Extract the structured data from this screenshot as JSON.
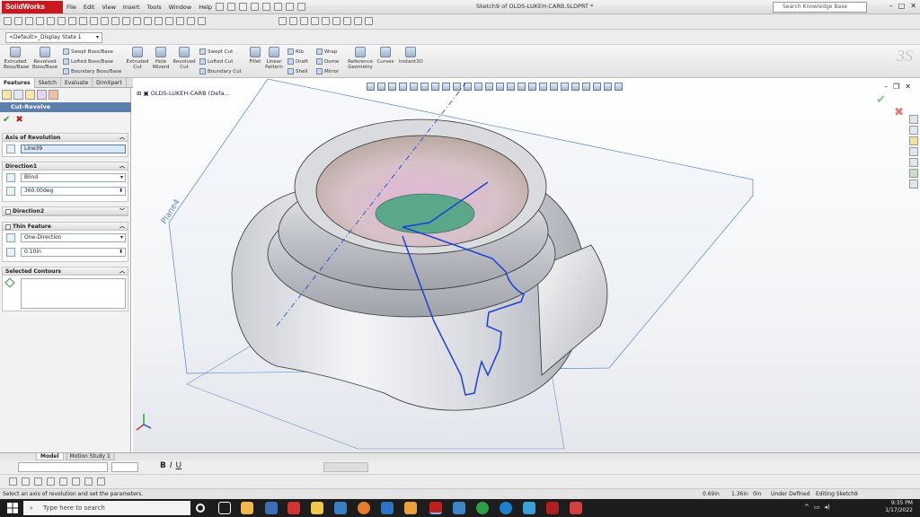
{
  "app": {
    "name": "SolidWorks",
    "doc_title": "Sketch9 of OLDS-LUKEH-CARB.SLDPRT *"
  },
  "menu": [
    "File",
    "Edit",
    "View",
    "Insert",
    "Tools",
    "Window",
    "Help"
  ],
  "search": {
    "placeholder": "Search Knowledge Base"
  },
  "config": {
    "selected": "<Default>_Display State 1"
  },
  "commands": {
    "extruded_boss": "Extruded Boss/Base",
    "revolved_boss": "Revolved Boss/Base",
    "swept_boss": "Swept Boss/Base",
    "lofted_boss": "Lofted Boss/Base",
    "boundary_boss": "Boundary Boss/Base",
    "extruded_cut": "Extruded Cut",
    "hole_wizard": "Hole Wizard",
    "revolved_cut": "Revolved Cut",
    "swept_cut": "Swept Cut",
    "lofted_cut": "Lofted Cut",
    "boundary_cut": "Boundary Cut",
    "fillet": "Fillet",
    "linear_pattern": "Linear Pattern",
    "rib": "Rib",
    "draft": "Draft",
    "shell": "Shell",
    "wrap": "Wrap",
    "dome": "Dome",
    "mirror": "Mirror",
    "reference_geometry": "Reference Geometry",
    "curves": "Curves",
    "instant3d": "Instant3D"
  },
  "cm_tabs": [
    "Features",
    "Sketch",
    "Evaluate",
    "DimXpert"
  ],
  "property_manager": {
    "title": "Cut-Revolve",
    "axis_section": "Axis of Revolution",
    "axis_value": "Line39",
    "direction1_section": "Direction1",
    "direction1_type": "Blind",
    "direction1_angle": "360.00deg",
    "direction2_section": "Direction2",
    "thin_section": "Thin Feature",
    "thin_type": "One-Direction",
    "thin_value": "0.10in",
    "contours_section": "Selected Contours"
  },
  "tree": {
    "root": "OLDS-LUKEH-CARB (Defa..."
  },
  "viewport": {
    "plane_label": "Plane4"
  },
  "bottom_tabs": [
    "Model",
    "Motion Study 1"
  ],
  "status": {
    "message": "Select an axis of revolution and set the parameters.",
    "x": "0.69in",
    "y": "1.36in",
    "z": "0in",
    "defined": "Under Defined",
    "editing": "Editing Sketch9"
  },
  "taskbar": {
    "search_placeholder": "Type here to search",
    "time": "9:35 PM",
    "date": "1/17/2022"
  }
}
